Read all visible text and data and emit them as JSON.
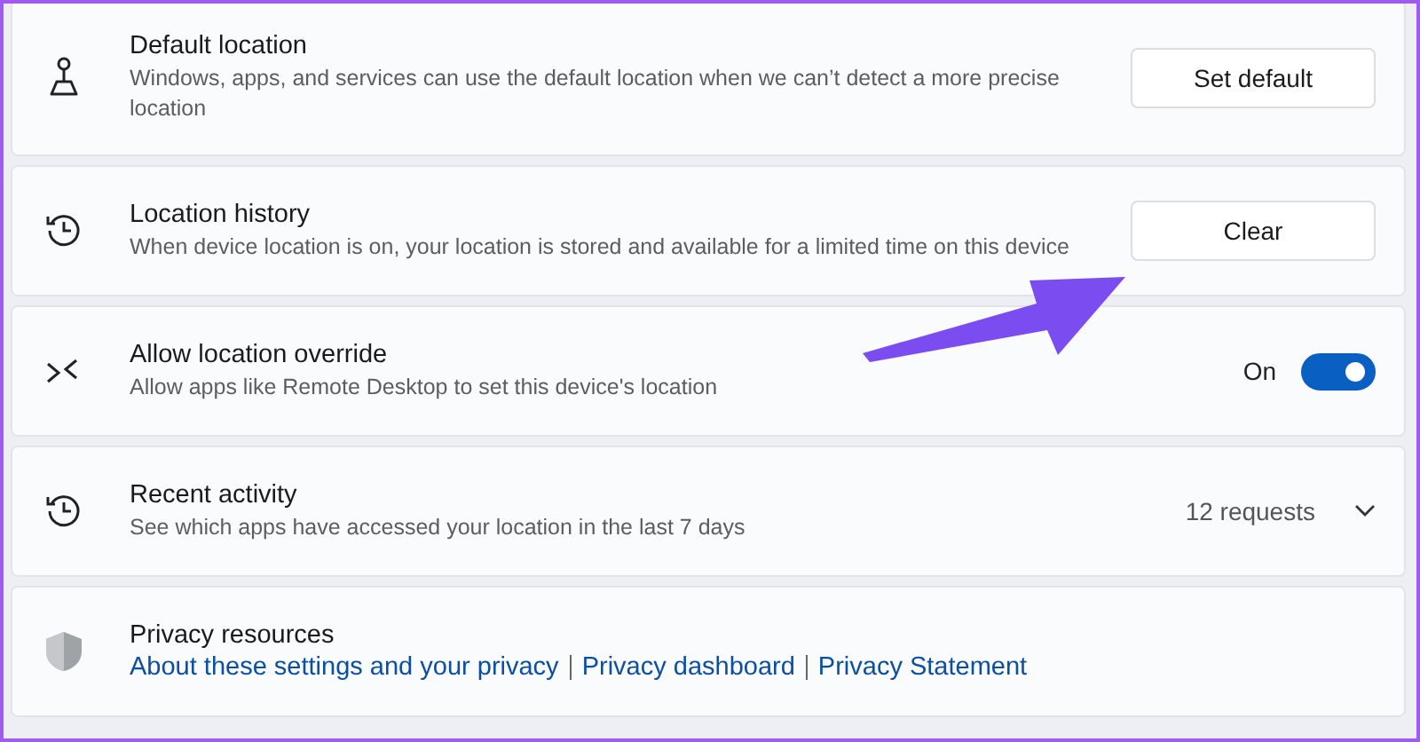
{
  "settings": [
    {
      "kind": "button",
      "title": "Default location",
      "description": "Windows, apps, and services can use the default location when we can’t detect a more precise location",
      "button": "Set default"
    },
    {
      "kind": "button",
      "title": "Location history",
      "description": "When device location is on, your location is stored and available for a limited time on this device",
      "button": "Clear"
    },
    {
      "kind": "toggle",
      "title": "Allow location override",
      "description": "Allow apps like Remote Desktop to set this device's location",
      "state_label": "On",
      "on": true
    },
    {
      "kind": "expander",
      "title": "Recent activity",
      "description": "See which apps have accessed your location in the last 7 days",
      "value": "12 requests",
      "expanded": false
    },
    {
      "kind": "links",
      "title": "Privacy resources",
      "links": [
        "About these settings and your privacy",
        "Privacy dashboard",
        "Privacy Statement"
      ]
    }
  ]
}
